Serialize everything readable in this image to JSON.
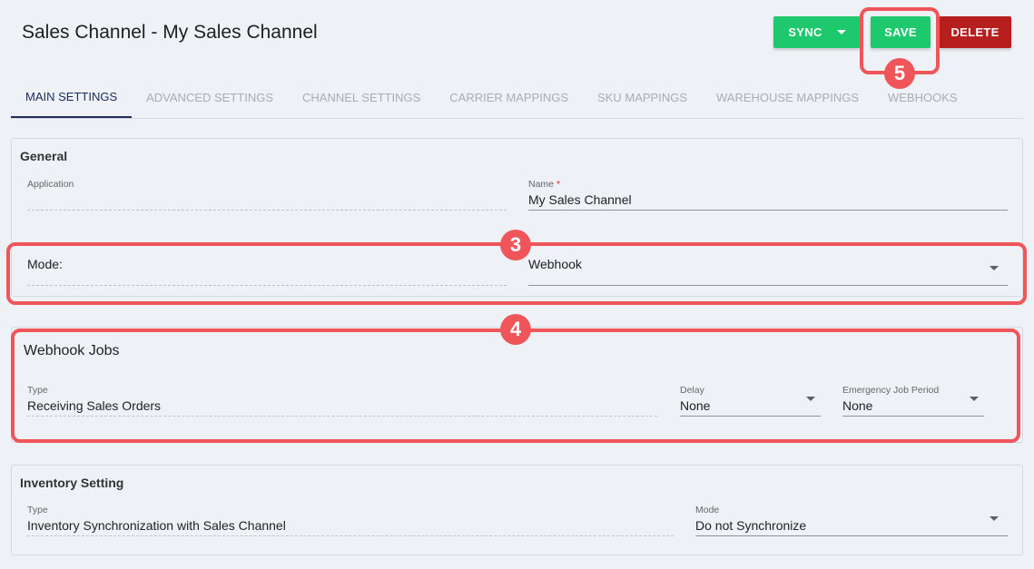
{
  "header": {
    "title": "Sales Channel - My Sales Channel",
    "sync_label": "SYNC",
    "save_label": "SAVE",
    "delete_label": "DELETE"
  },
  "tabs": [
    {
      "label": "MAIN SETTINGS",
      "active": true
    },
    {
      "label": "ADVANCED SETTINGS"
    },
    {
      "label": "CHANNEL SETTINGS"
    },
    {
      "label": "CARRIER MAPPINGS"
    },
    {
      "label": "SKU MAPPINGS"
    },
    {
      "label": "WAREHOUSE MAPPINGS"
    },
    {
      "label": "WEBHOOKS"
    }
  ],
  "general": {
    "title": "General",
    "application_label": "Application",
    "application_value": "",
    "name_label": "Name",
    "name_required": "*",
    "name_value": "My Sales Channel",
    "mode_label": "Mode:",
    "mode_value": "Webhook"
  },
  "webhook_jobs": {
    "title": "Webhook Jobs",
    "type_label": "Type",
    "type_value": "Receiving Sales Orders",
    "delay_label": "Delay",
    "delay_value": "None",
    "emergency_label": "Emergency Job Period",
    "emergency_value": "None"
  },
  "inventory": {
    "title": "Inventory Setting",
    "type_label": "Type",
    "type_value": "Inventory Synchronization with Sales Channel",
    "mode_label": "Mode",
    "mode_value": "Do not Synchronize"
  },
  "annotations": {
    "badge_3": "3",
    "badge_4": "4",
    "badge_5": "5"
  },
  "colors": {
    "accent_green": "#1ec86c",
    "danger_red": "#b71f1f",
    "highlight": "#f0555a",
    "active_tab": "#1e2a5a"
  }
}
